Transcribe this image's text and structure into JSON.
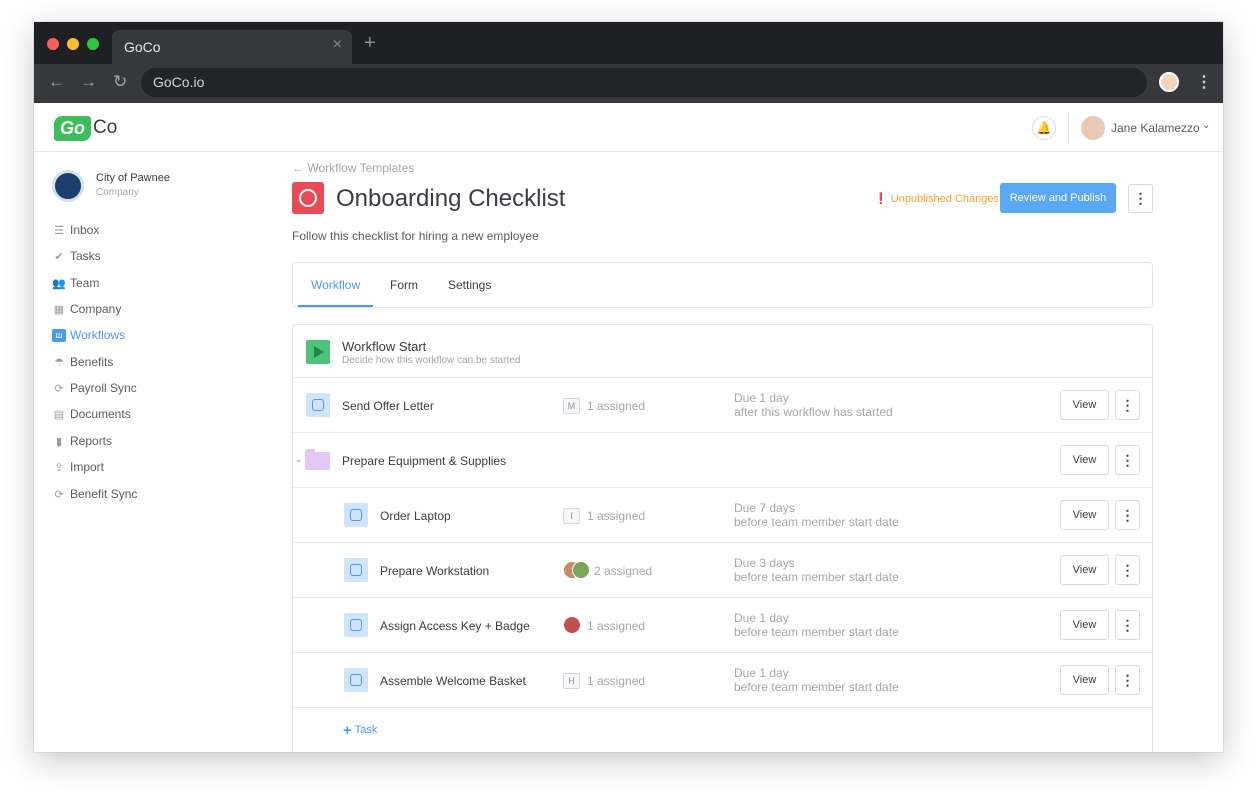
{
  "browser": {
    "tab_title": "GoCo",
    "url": "GoCo.io",
    "close_glyph": "×",
    "newtab_glyph": "+",
    "back_glyph": "←",
    "forward_glyph": "→",
    "reload_glyph": "↻",
    "menu_glyph": "⋮"
  },
  "header": {
    "logo_go": "Go",
    "logo_co": "Co",
    "user_name": "Jane Kalamezzo",
    "bell_glyph": "🔔",
    "chevron_glyph": "⌄"
  },
  "sidebar": {
    "company_name": "City of Pawnee",
    "company_sub": "Company",
    "items": [
      {
        "label": "Inbox",
        "icon": "inbox-icon",
        "glyph": "☰"
      },
      {
        "label": "Tasks",
        "icon": "check-icon",
        "glyph": "✔"
      },
      {
        "label": "Team",
        "icon": "team-icon",
        "glyph": "👥"
      },
      {
        "label": "Company",
        "icon": "building-icon",
        "glyph": "▦"
      },
      {
        "label": "Workflows",
        "icon": "workflow-icon",
        "glyph": "ш"
      },
      {
        "label": "Benefits",
        "icon": "umbrella-icon",
        "glyph": "☂"
      },
      {
        "label": "Payroll Sync",
        "icon": "sync-icon",
        "glyph": "⟳"
      },
      {
        "label": "Documents",
        "icon": "document-icon",
        "glyph": "▤"
      },
      {
        "label": "Reports",
        "icon": "bar-chart-icon",
        "glyph": "▮"
      },
      {
        "label": "Import",
        "icon": "upload-icon",
        "glyph": "⇪"
      },
      {
        "label": "Benefit Sync",
        "icon": "sync-icon",
        "glyph": "⟳"
      }
    ],
    "active_item": "Workflows"
  },
  "page": {
    "back_link": "← Workflow Templates",
    "title": "Onboarding Checklist",
    "unpublished": "❗ Unpublished Changes",
    "publish_label": "Review and Publish",
    "more_glyph": "⋮",
    "description": "Follow this checklist for hiring a new employee",
    "tabs": [
      "Workflow",
      "Form",
      "Settings"
    ]
  },
  "workflow": {
    "start_title": "Workflow Start",
    "start_sub": "Decide how this workflow can be started",
    "view_label": "View",
    "more_glyph": "⋮",
    "folder_chevron": "⌄",
    "rows": [
      {
        "name": "Send Offer Letter",
        "badge": "M",
        "assigned": "1 assigned",
        "due": "Due 1 day",
        "due_detail": "after this workflow has started"
      },
      {
        "name": "Prepare Equipment & Supplies"
      },
      {
        "name": "Order Laptop",
        "badge": "I",
        "assigned": "1 assigned",
        "due": "Due 7 days",
        "due_detail": "before team member start date"
      },
      {
        "name": "Prepare Workstation",
        "assigned": "2 assigned",
        "due": "Due 3 days",
        "due_detail": "before team member start date"
      },
      {
        "name": "Assign Access Key + Badge",
        "assigned": "1 assigned",
        "due": "Due 1 day",
        "due_detail": "before team member start date"
      },
      {
        "name": "Assemble Welcome Basket",
        "badge": "H",
        "assigned": "1 assigned",
        "due": "Due 1 day",
        "due_detail": "before team member start date"
      }
    ],
    "add_task_plus": "+",
    "add_task_label": "Task"
  }
}
